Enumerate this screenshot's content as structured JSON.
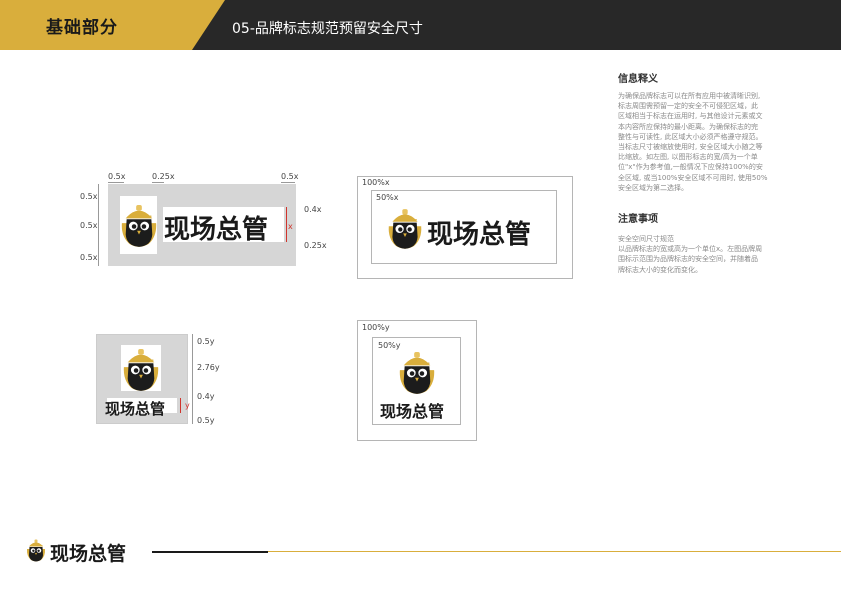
{
  "header": {
    "section_title": "基础部分",
    "page_title": "05-品牌标志规范预留安全尺寸"
  },
  "info": {
    "heading": "信息释义",
    "body": [
      "为确保品牌标志可以在所有应用中被清晰识别,",
      "标志周围需预留一定的安全不可侵犯区域，此",
      "区域相当于标志在运用时, 与其他设计元素或文",
      "本内容所应保持的最小距离。为确保标志的完",
      "整性与可读性, 此区域大小必须严格遵守规范。",
      "当标志尺寸被缩放使用时, 安全区域大小随之等",
      "比缩放。如左图, 以图形标志的宽/高为一个单",
      "位\"x\"作为参考值,一般情况下应保持100%的安",
      "全区域, 或当100%安全区域不可用时, 使用50%",
      "安全区域为第二选择。"
    ]
  },
  "notes": {
    "heading": "注意事项",
    "body": [
      "安全空间尺寸规范",
      "以品牌标志的宽或高为一个单位x。左图品牌周",
      "围标示范围为品牌标志的安全空间，并随着品",
      "牌标志大小的变化而变化。"
    ]
  },
  "logo": {
    "text": "现场总管",
    "icon": "owl-with-hardhat-icon"
  },
  "diagram_h": {
    "top_labels": [
      "0.5x",
      "0.25x",
      "0.5x"
    ],
    "left_labels": [
      "0.5x",
      "0.5x",
      "0.5x"
    ],
    "right_labels": [
      "0.4x",
      "0.25x"
    ],
    "unit_label": "x"
  },
  "diagram_v": {
    "right_labels": [
      "0.5y",
      "2.76y",
      "0.4y",
      "0.5y"
    ],
    "unit_label": "y"
  },
  "safe_h": {
    "outer": "100%x",
    "inner": "50%x"
  },
  "safe_v": {
    "outer": "100%y",
    "inner": "50%y"
  },
  "colors": {
    "gold": "#d9ae3c",
    "dark": "#282828",
    "gray": "#d6d6d6",
    "red": "#d0342c"
  }
}
